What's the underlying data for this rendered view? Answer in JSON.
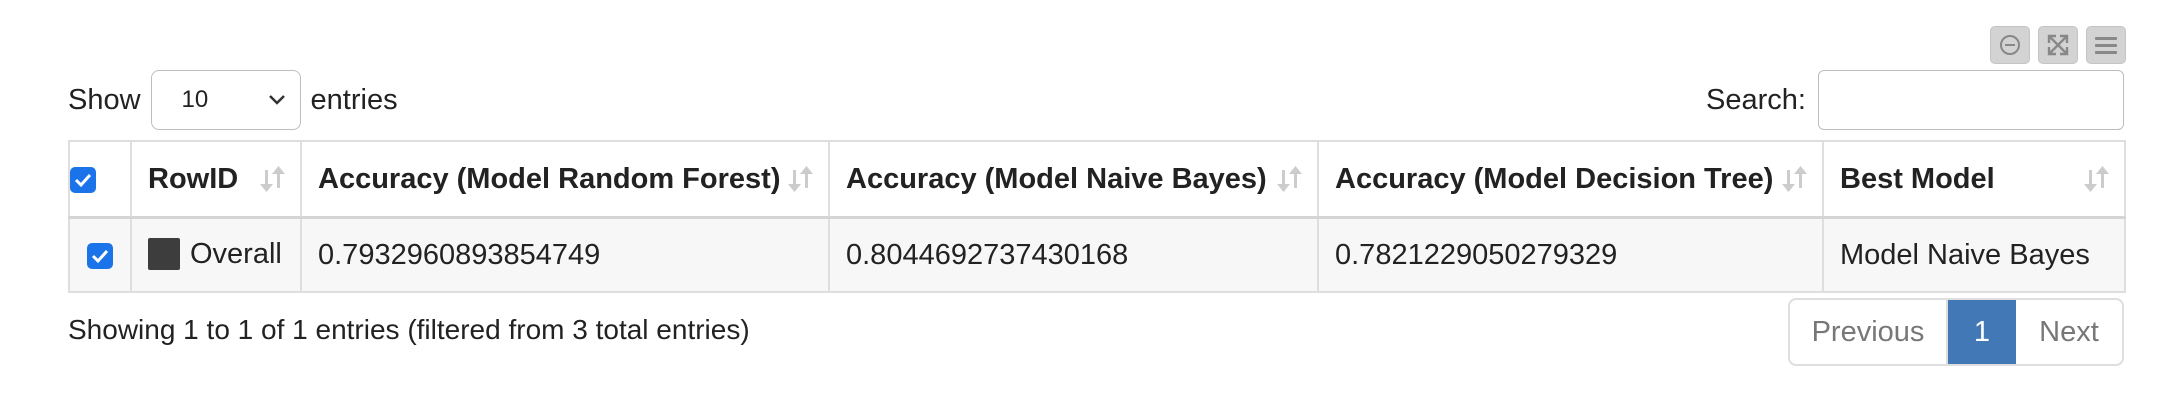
{
  "toolbar": {
    "icons": [
      "minimize-icon",
      "fullscreen-icon",
      "menu-icon"
    ]
  },
  "length": {
    "show_label": "Show",
    "selected": "10",
    "entries_label": "entries"
  },
  "search": {
    "label": "Search:",
    "value": ""
  },
  "table": {
    "columns": [
      "RowID",
      "Accuracy (Model Random Forest)",
      "Accuracy (Model Naive Bayes)",
      "Accuracy (Model Decision Tree)",
      "Best Model"
    ],
    "rows": [
      {
        "checked": true,
        "rowid": "Overall",
        "swatch_color": "#3d3d3d",
        "rf": "0.7932960893854749",
        "nb": "0.8044692737430168",
        "dt": "0.7821229050279329",
        "best": "Model Naive Bayes"
      }
    ],
    "header_checked": true
  },
  "info": "Showing 1 to 1 of 1 entries (filtered from 3 total entries)",
  "pagination": {
    "previous": "Previous",
    "current": "1",
    "next": "Next"
  },
  "colors": {
    "accent": "#4378b7",
    "checkbox": "#1a73e8"
  }
}
